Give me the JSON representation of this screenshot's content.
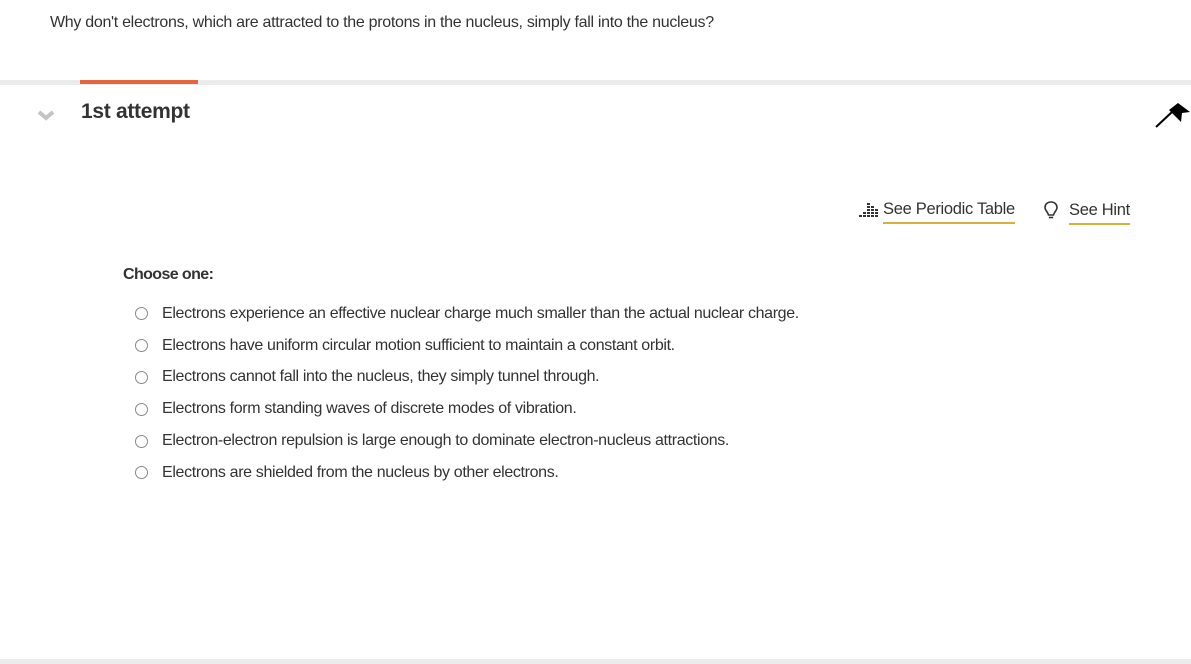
{
  "question": {
    "text": "Why don't electrons, which are attracted to the protons in the nucleus, simply fall into the nucleus?"
  },
  "attempt": {
    "title": "1st attempt",
    "collapse_icon": "chevron-down-icon",
    "flag_icon": "flag-icon",
    "accent_color": "#e8643f"
  },
  "tools": {
    "periodic_table": {
      "label": "See Periodic Table",
      "icon": "periodic-table-icon"
    },
    "hint": {
      "label": "See Hint",
      "icon": "lightbulb-icon"
    },
    "underline_color": "#d6b23a"
  },
  "choices": {
    "prompt": "Choose one:",
    "options": [
      {
        "label": "Electrons experience an effective nuclear charge much smaller than the actual nuclear charge.",
        "selected": false
      },
      {
        "label": "Electrons have uniform circular motion sufficient to maintain a constant orbit.",
        "selected": false
      },
      {
        "label": "Electrons cannot fall into the nucleus, they simply tunnel through.",
        "selected": false
      },
      {
        "label": "Electrons form standing waves of discrete modes of vibration.",
        "selected": false
      },
      {
        "label": "Electron-electron repulsion is large enough to dominate electron-nucleus attractions.",
        "selected": false
      },
      {
        "label": "Electrons are shielded from the nucleus by other electrons.",
        "selected": false
      }
    ]
  }
}
